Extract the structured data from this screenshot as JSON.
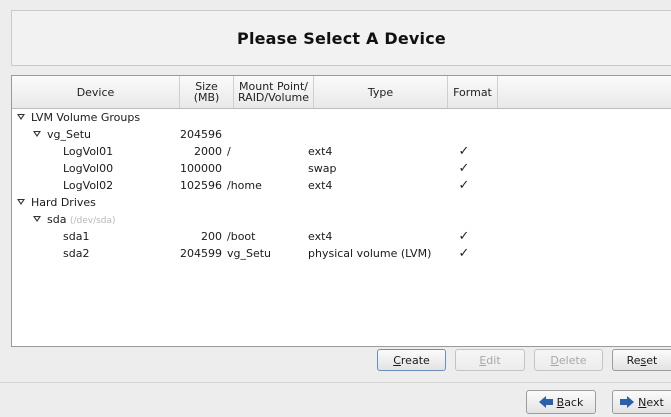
{
  "header": {
    "title": "Please Select A Device"
  },
  "columns": {
    "device": "Device",
    "size_line1": "Size",
    "size_line2": "(MB)",
    "mount_line1": "Mount Point/",
    "mount_line2": "RAID/Volume",
    "type": "Type",
    "format": "Format"
  },
  "rows": [
    {
      "device": "LVM Volume Groups",
      "size": "",
      "mount": "",
      "type": "",
      "format": ""
    },
    {
      "device": "vg_Setu",
      "size": "204596",
      "mount": "",
      "type": "",
      "format": ""
    },
    {
      "device": "LogVol01",
      "size": "2000",
      "mount": "/",
      "type": "ext4",
      "format": "✓"
    },
    {
      "device": "LogVol00",
      "size": "100000",
      "mount": "",
      "type": "swap",
      "format": "✓"
    },
    {
      "device": "LogVol02",
      "size": "102596",
      "mount": "/home",
      "type": "ext4",
      "format": "✓"
    },
    {
      "device": "Hard Drives",
      "size": "",
      "mount": "",
      "type": "",
      "format": ""
    },
    {
      "device": "sda",
      "device_path": "(/dev/sda)",
      "size": "",
      "mount": "",
      "type": "",
      "format": ""
    },
    {
      "device": "sda1",
      "size": "200",
      "mount": "/boot",
      "type": "ext4",
      "format": "✓"
    },
    {
      "device": "sda2",
      "size": "204599",
      "mount": "vg_Setu",
      "type": "physical volume (LVM)",
      "format": "✓"
    }
  ],
  "actions": {
    "create": {
      "pre": "",
      "key": "C",
      "post": "reate"
    },
    "edit": {
      "pre": "",
      "key": "E",
      "post": "dit"
    },
    "delete": {
      "pre": "",
      "key": "D",
      "post": "elete"
    },
    "reset": {
      "pre": "Re",
      "key": "s",
      "post": "et"
    }
  },
  "nav": {
    "back": {
      "key": "B",
      "post": "ack"
    },
    "next": {
      "key": "N",
      "post": "ext"
    }
  },
  "colors": {
    "accent": "#2b5fa8",
    "disabled_text": "#a8a8a8"
  }
}
